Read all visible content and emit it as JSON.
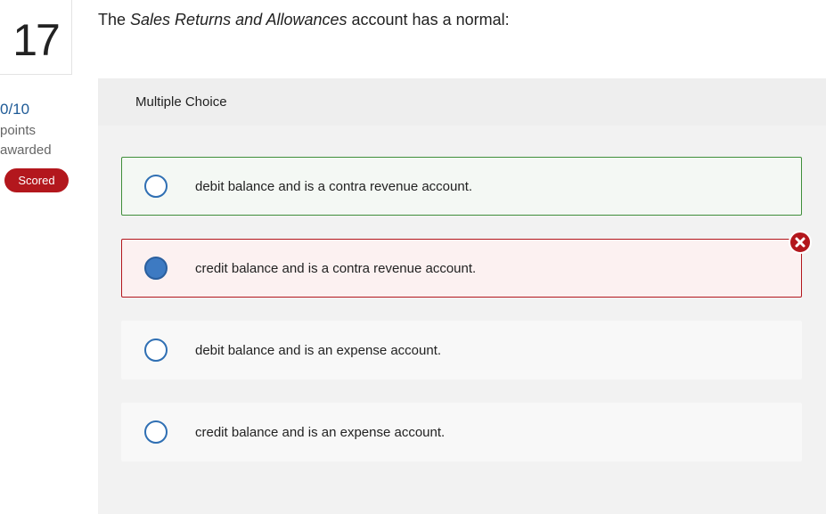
{
  "question": {
    "number": "17",
    "prompt_before": "The ",
    "prompt_italic": "Sales Returns and Allowances",
    "prompt_after": " account has a normal:"
  },
  "score": {
    "points": "0/10",
    "points_label_1": "points",
    "points_label_2": "awarded",
    "badge": "Scored"
  },
  "panel": {
    "type_label": "Multiple Choice"
  },
  "choices": [
    {
      "text": "debit balance and is a contra revenue account.",
      "state": "correct",
      "selected": false
    },
    {
      "text": "credit balance and is a contra revenue account.",
      "state": "incorrect",
      "selected": true
    },
    {
      "text": "debit balance and is an expense account.",
      "state": "neutral",
      "selected": false
    },
    {
      "text": "credit balance and is an expense account.",
      "state": "neutral",
      "selected": false
    }
  ],
  "icons": {
    "incorrect_marker": "x-circle-icon",
    "radio": "radio-icon"
  },
  "colors": {
    "accent_blue": "#2f6fb3",
    "correct_green": "#3f8e3a",
    "incorrect_red": "#b3171d",
    "panel_bg": "#f2f2f2"
  }
}
